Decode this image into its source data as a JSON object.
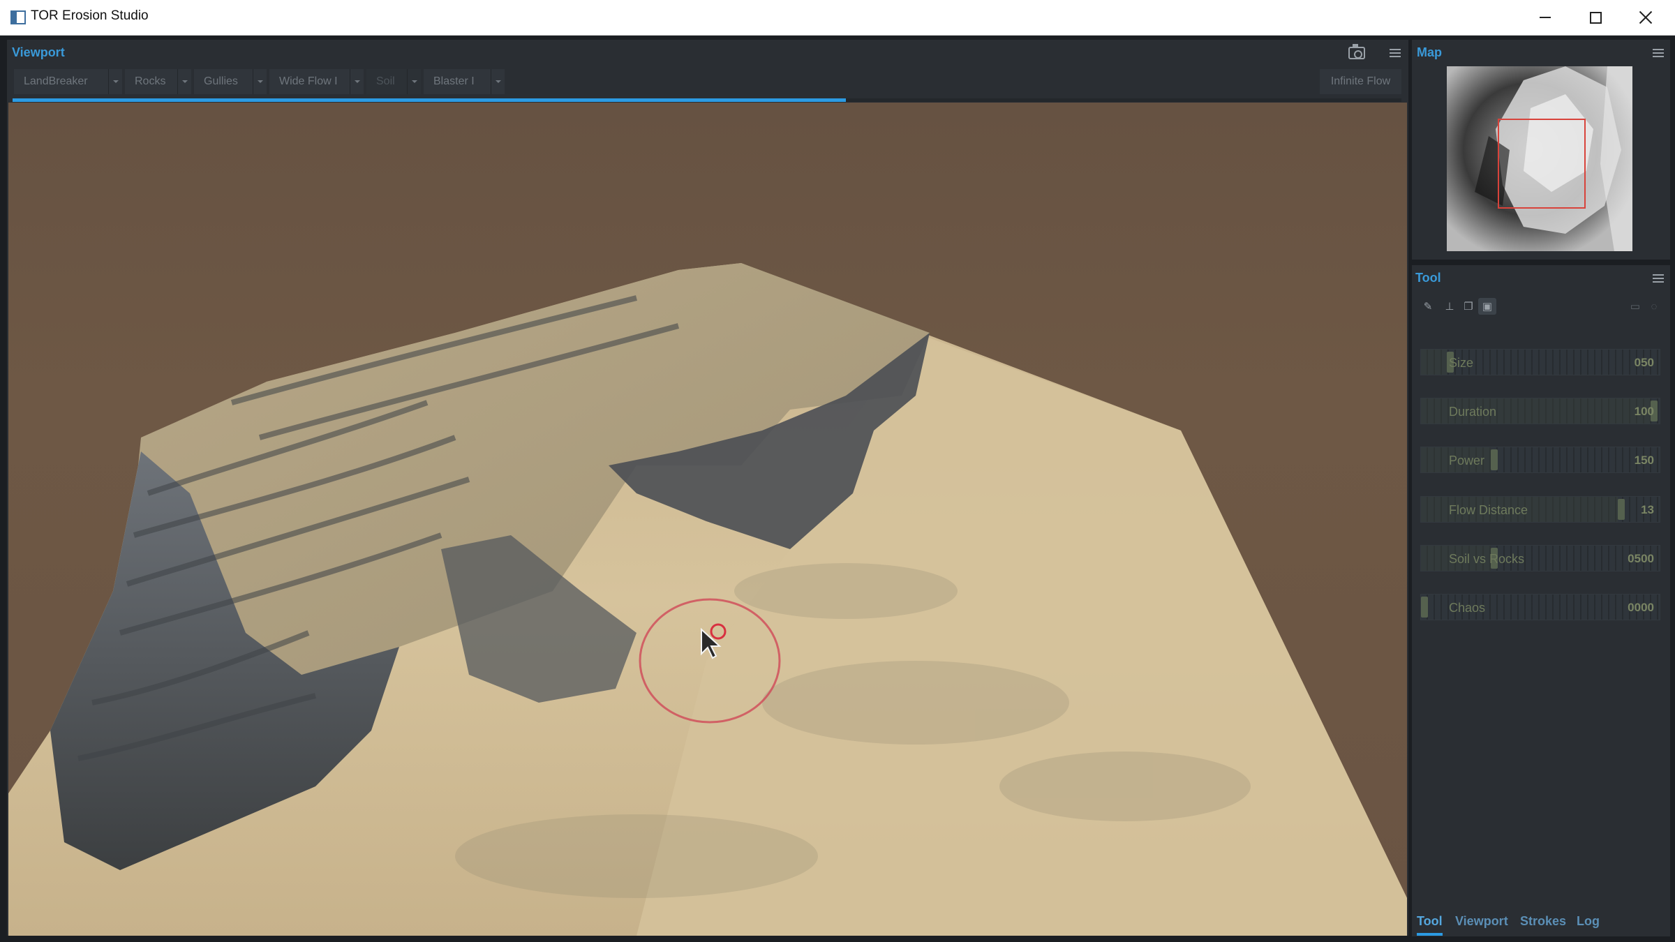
{
  "window": {
    "title": "TOR Erosion Studio"
  },
  "viewport": {
    "title": "Viewport",
    "tools": [
      {
        "label": "LandBreaker"
      },
      {
        "label": "Rocks"
      },
      {
        "label": "Gullies"
      },
      {
        "label": "Wide Flow I"
      },
      {
        "label": "Soil"
      },
      {
        "label": "Blaster I"
      }
    ],
    "selected_tool": "Soil",
    "infinite_flow_label": "Infinite Flow",
    "progress": 0.6
  },
  "map": {
    "title": "Map"
  },
  "tool": {
    "title": "Tool",
    "sliders": [
      {
        "label": "Size",
        "value": "050",
        "level": 0.11
      },
      {
        "label": "Duration",
        "value": "100",
        "level": 0.99
      },
      {
        "label": "Power",
        "value": "150",
        "level": 0.3
      },
      {
        "label": "Flow Distance",
        "value": "13",
        "level": 0.85
      },
      {
        "label": "Soil vs Rocks",
        "value": "0500",
        "level": 0.3
      },
      {
        "label": "Chaos",
        "value": "0000",
        "level": 0.0
      }
    ]
  },
  "bottom_tabs": [
    {
      "label": "Tool"
    },
    {
      "label": "Viewport"
    },
    {
      "label": "Strokes"
    },
    {
      "label": "Log"
    }
  ],
  "active_bottom_tab": "Tool"
}
